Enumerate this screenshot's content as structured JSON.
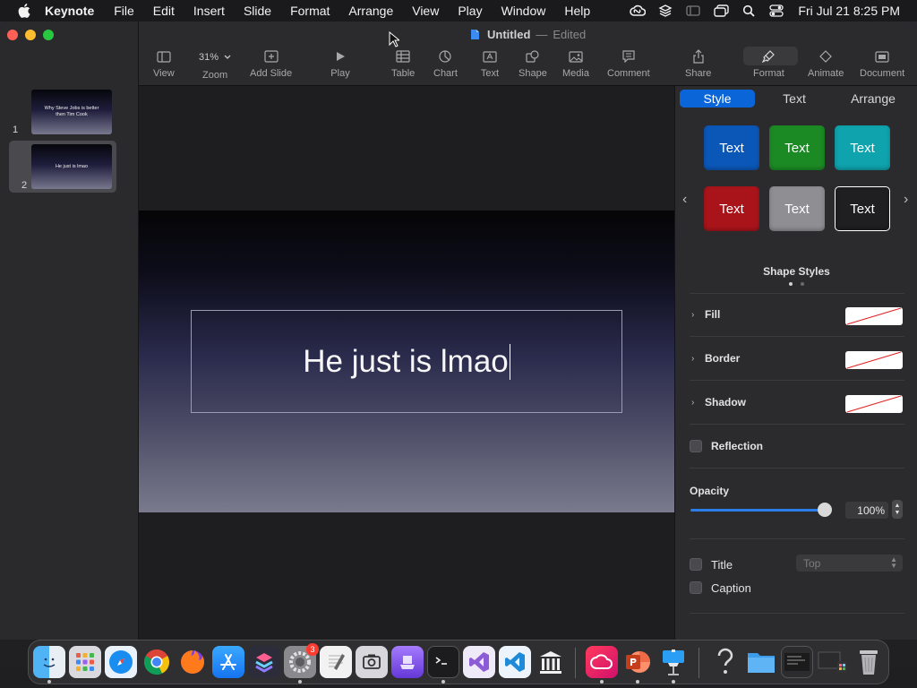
{
  "menubar": {
    "app_name": "Keynote",
    "items": [
      "File",
      "Edit",
      "Insert",
      "Slide",
      "Format",
      "Arrange",
      "View",
      "Play",
      "Window",
      "Help"
    ],
    "clock": "Fri Jul 21  8:25 PM"
  },
  "window": {
    "document_name": "Untitled",
    "separator": "—",
    "document_status": "Edited"
  },
  "toolbar": {
    "view": "View",
    "zoom_value": "31%",
    "zoom": "Zoom",
    "add_slide": "Add Slide",
    "play": "Play",
    "table": "Table",
    "chart": "Chart",
    "text": "Text",
    "shape": "Shape",
    "media": "Media",
    "comment": "Comment",
    "share": "Share",
    "format": "Format",
    "animate": "Animate",
    "document": "Document"
  },
  "slides": [
    {
      "number": "1",
      "text": "Why Steve Jobs is better then Tim Cook"
    },
    {
      "number": "2",
      "text": "He just is lmao"
    }
  ],
  "canvas": {
    "text_box_content": "He just is lmao"
  },
  "inspector": {
    "tabs": [
      "Style",
      "Text",
      "Arrange"
    ],
    "style_swatch_label": "Text",
    "swatch_colors": [
      "#0b57b8",
      "#1c8a24",
      "#0fa3ad",
      "#a8141a",
      "#8e8e93",
      "#1f1f21"
    ],
    "shape_styles_label": "Shape Styles",
    "fill": "Fill",
    "border": "Border",
    "shadow": "Shadow",
    "reflection": "Reflection",
    "opacity_label": "Opacity",
    "opacity_value": "100%",
    "opacity_level": 1.0,
    "title": "Title",
    "title_position": "Top",
    "caption": "Caption"
  },
  "dock": {
    "apps": [
      "finder",
      "launchpad",
      "safari",
      "chrome",
      "firefox",
      "app-store",
      "shortcuts",
      "system-settings",
      "textedit",
      "screenshot",
      "simulator",
      "terminal",
      "visual-studio",
      "vscode",
      "library",
      "creative-cloud",
      "powerpoint",
      "keynote",
      "help",
      "downloads-folder",
      "window-preview",
      "window-preview-2",
      "trash"
    ],
    "settings_badge": "3"
  },
  "colors": {
    "accent": "#0a66d8",
    "menubar_bg": "#1a1a1c",
    "toolbar_bg": "#2b2b2d"
  }
}
